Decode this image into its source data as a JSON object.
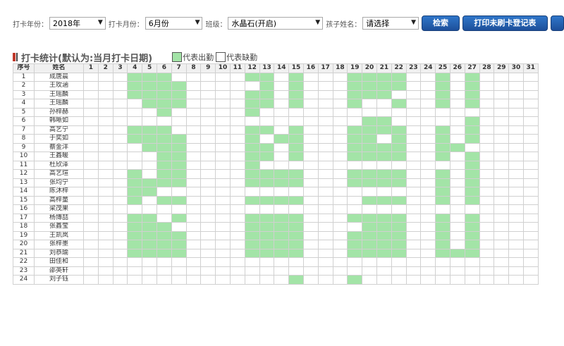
{
  "filters": {
    "year_label": "打卡年份：",
    "year_value": "2018年",
    "month_label": "打卡月份：",
    "month_value": "6月份",
    "class_label": "班级：",
    "class_value": "水晶石(开启)",
    "child_label": "孩子姓名：",
    "child_value": "请选择"
  },
  "buttons": {
    "search": "检索",
    "print": "打印未刷卡登记表"
  },
  "section": {
    "title": "打卡统计(默认为:当月打卡日期)",
    "legend_present": "代表出勤",
    "legend_absent": "代表缺勤"
  },
  "colors": {
    "present": "#a3e4a7",
    "absent": "#ffffff",
    "button": "#1d4f9a",
    "title_mark_red": "#c0392b",
    "title_mark_dark": "#444444"
  },
  "table": {
    "col_index": "序号",
    "col_name": "姓名",
    "days": [
      "1",
      "2",
      "3",
      "4",
      "5",
      "6",
      "7",
      "8",
      "9",
      "10",
      "11",
      "12",
      "13",
      "14",
      "15",
      "16",
      "17",
      "18",
      "19",
      "20",
      "21",
      "22",
      "23",
      "24",
      "25",
      "26",
      "27",
      "28",
      "29",
      "30",
      "31"
    ],
    "rows": [
      {
        "no": "1",
        "name": "成唐晨",
        "present": [
          4,
          5,
          6,
          12,
          13,
          15,
          19,
          20,
          21,
          22,
          25,
          27
        ]
      },
      {
        "no": "2",
        "name": "王玫涵",
        "present": [
          4,
          5,
          6,
          7,
          13,
          15,
          19,
          20,
          21,
          22,
          25,
          27
        ]
      },
      {
        "no": "3",
        "name": "王瑶麟",
        "present": [
          4,
          5,
          6,
          7,
          12,
          13,
          15,
          19,
          20,
          21,
          25,
          27
        ]
      },
      {
        "no": "4",
        "name": "王瑶麟",
        "present": [
          5,
          6,
          7,
          12,
          13,
          15,
          19,
          22,
          25,
          27
        ]
      },
      {
        "no": "5",
        "name": "孙梓赫",
        "present": [
          6,
          12
        ]
      },
      {
        "no": "6",
        "name": "韩晰如",
        "present": [
          20,
          21,
          27
        ]
      },
      {
        "no": "7",
        "name": "高艺宁",
        "present": [
          4,
          5,
          6,
          12,
          13,
          15,
          19,
          20,
          21,
          22,
          25,
          27
        ]
      },
      {
        "no": "8",
        "name": "于奕如",
        "present": [
          4,
          5,
          6,
          7,
          12,
          14,
          15,
          19,
          20,
          22,
          25,
          27
        ]
      },
      {
        "no": "9",
        "name": "蔡金洋",
        "present": [
          5,
          6,
          7,
          12,
          13,
          15,
          19,
          20,
          21,
          22,
          25,
          26
        ]
      },
      {
        "no": "10",
        "name": "王鑫暖",
        "present": [
          6,
          7,
          12,
          13,
          15,
          19,
          20,
          21,
          22,
          25,
          27
        ]
      },
      {
        "no": "11",
        "name": "杜欣泽",
        "present": [
          6,
          7,
          12,
          27
        ]
      },
      {
        "no": "12",
        "name": "高艺瑄",
        "present": [
          4,
          6,
          7,
          12,
          13,
          14,
          15,
          19,
          20,
          21,
          22,
          25,
          27
        ]
      },
      {
        "no": "13",
        "name": "张均宁",
        "present": [
          4,
          5,
          6,
          7,
          12,
          13,
          14,
          15,
          19,
          20,
          21,
          22,
          25,
          27
        ]
      },
      {
        "no": "14",
        "name": "陈沐梓",
        "present": [
          4,
          5,
          25,
          27
        ]
      },
      {
        "no": "15",
        "name": "高梓童",
        "present": [
          4,
          6,
          7,
          12,
          13,
          14,
          15,
          20,
          21,
          22,
          25,
          27
        ]
      },
      {
        "no": "16",
        "name": "梁茂果",
        "present": []
      },
      {
        "no": "17",
        "name": "杨博喆",
        "present": [
          4,
          5,
          7,
          12,
          13,
          14,
          15,
          19,
          20,
          21,
          22,
          25,
          27
        ]
      },
      {
        "no": "18",
        "name": "张鑫莹",
        "present": [
          4,
          5,
          6,
          12,
          13,
          14,
          15,
          20,
          21,
          22,
          25,
          27
        ]
      },
      {
        "no": "19",
        "name": "王凯岚",
        "present": [
          4,
          5,
          6,
          7,
          12,
          13,
          14,
          15,
          19,
          20,
          21,
          22,
          25,
          27
        ]
      },
      {
        "no": "20",
        "name": "张梓墨",
        "present": [
          4,
          5,
          6,
          7,
          12,
          13,
          14,
          15,
          19,
          20,
          21,
          22,
          25,
          27
        ]
      },
      {
        "no": "21",
        "name": "刘恭瑜",
        "present": [
          4,
          5,
          6,
          7,
          12,
          13,
          14,
          15,
          19,
          20,
          21,
          22,
          25,
          26,
          27
        ]
      },
      {
        "no": "22",
        "name": "田佳和",
        "present": []
      },
      {
        "no": "23",
        "name": "邵英轩",
        "present": []
      },
      {
        "no": "24",
        "name": "刘子钰",
        "present": [
          15,
          19
        ]
      }
    ]
  }
}
